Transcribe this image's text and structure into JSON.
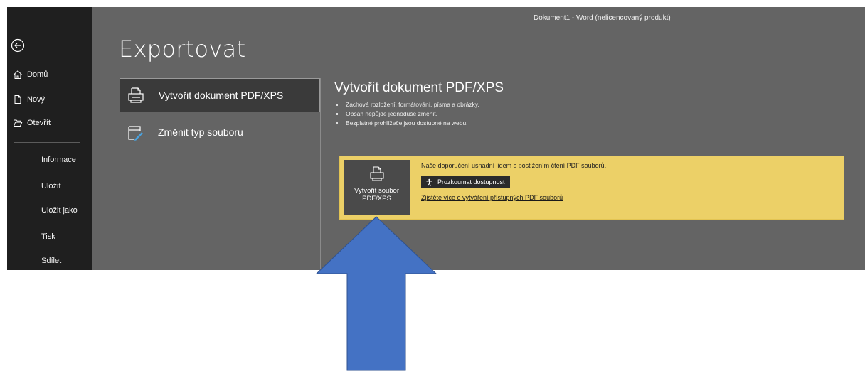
{
  "window": {
    "title": "Dokument1  -  Word (nelicencovaný produkt)"
  },
  "sidebar": {
    "back_icon": "back-arrow-icon",
    "items": [
      {
        "label": "Domů",
        "icon": "home-icon"
      },
      {
        "label": "Nový",
        "icon": "new-document-icon"
      },
      {
        "label": "Otevřít",
        "icon": "open-folder-icon"
      },
      {
        "label": "Informace"
      },
      {
        "label": "Uložit"
      },
      {
        "label": "Uložit jako"
      },
      {
        "label": "Tisk"
      },
      {
        "label": "Sdílet"
      }
    ]
  },
  "main": {
    "title": "Exportovat",
    "options": [
      {
        "label": "Vytvořit dokument PDF/XPS",
        "icon": "pdf-document-icon",
        "selected": true
      },
      {
        "label": "Změnit typ souboru",
        "icon": "change-file-type-icon",
        "selected": false
      }
    ],
    "detail": {
      "heading": "Vytvořit dokument PDF/XPS",
      "bullets": [
        "Zachová rozložení, formátování, písma a obrázky.",
        "Obsah nepůjde jednoduše změnit.",
        "Bezplatné prohlížeče jsou dostupné na webu."
      ]
    },
    "banner": {
      "create_button_line1": "Vytvořit soubor",
      "create_button_line2": "PDF/XPS",
      "recommendation": "Naše doporučení usnadní lidem s postižením čtení PDF souborů.",
      "accessibility_button": "Prozkoumat dostupnost",
      "learn_link": "Zjistěte více o vytváření přístupných PDF souborů"
    }
  },
  "colors": {
    "sidebar_bg": "#1f1f1f",
    "main_bg": "#646464",
    "banner_bg": "#ecd067",
    "selected_option_bg": "#3a3a3a",
    "annotation_arrow": "#4472c4"
  }
}
